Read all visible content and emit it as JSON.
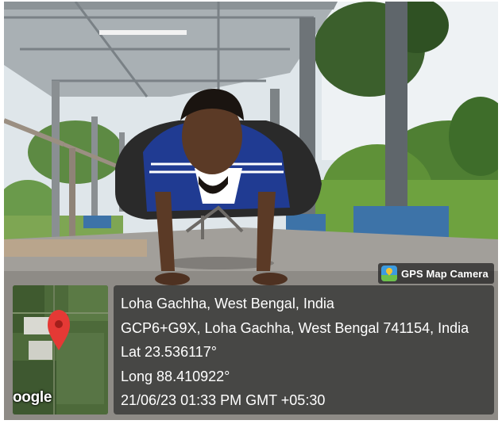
{
  "badge": {
    "icon": "gps-map-camera-app-icon",
    "label": "GPS Map Camera"
  },
  "location": {
    "place": "Loha Gachha, West Bengal, India",
    "address": "GCP6+G9X, Loha Gachha, West Bengal 741154, India",
    "latitude": "Lat 23.536117°",
    "longitude": "Long 88.410922°",
    "datetime": "21/06/23 01:33 PM GMT +05:30"
  },
  "map": {
    "brand": "oogle",
    "pin_icon": "map-pin-icon",
    "pin_color": "#e53935"
  }
}
